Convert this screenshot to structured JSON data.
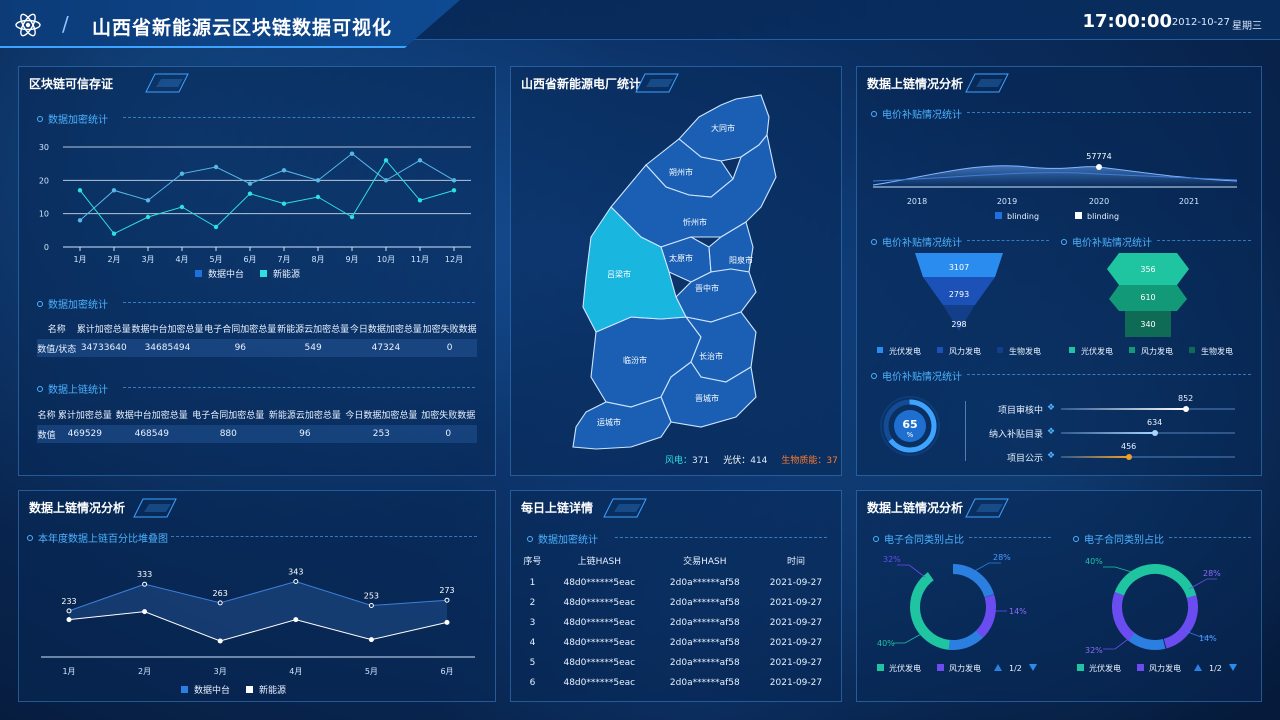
{
  "header": {
    "title": "山西省新能源云区块链数据可视化",
    "time": "17:00:00",
    "date": "2012-10-27",
    "weekday": "星期三",
    "logo_icon": "atom-icon"
  },
  "panel_tl": {
    "title": "区块链可信存证",
    "line_sub": "数据加密统计",
    "chart_data": {
      "type": "line",
      "categories": [
        "1月",
        "2月",
        "3月",
        "4月",
        "5月",
        "6月",
        "7月",
        "8月",
        "9月",
        "10月",
        "11月",
        "12月"
      ],
      "series": [
        {
          "name": "数据中台",
          "values": [
            8,
            17,
            14,
            22,
            24,
            19,
            23,
            20,
            28,
            20,
            26,
            20
          ]
        },
        {
          "name": "新能源",
          "values": [
            17,
            4,
            9,
            12,
            6,
            16,
            13,
            15,
            9,
            26,
            14,
            17
          ]
        }
      ],
      "yticks": [
        "0",
        "10",
        "20",
        "30"
      ],
      "ylim": [
        0,
        30
      ]
    },
    "table1": {
      "sub": "数据加密统计",
      "headers": [
        "名称",
        "累计加密总量",
        "数据中台加密总量",
        "电子合同加密总量",
        "新能源云加密总量",
        "今日数据加密总量",
        "加密失败数据"
      ],
      "row": [
        "数值/状态",
        "34733640",
        "34685494",
        "96",
        "549",
        "47324",
        "0"
      ]
    },
    "table2": {
      "sub": "数据上链统计",
      "headers": [
        "名称",
        "累计加密总量",
        "数据中台加密总量",
        "电子合同加密总量",
        "新能源云加密总量",
        "今日数据加密总量",
        "加密失败数据"
      ],
      "row": [
        "数值",
        "469529",
        "468549",
        "880",
        "96",
        "253",
        "0"
      ]
    }
  },
  "panel_map": {
    "title": "山西省新能源电厂统计",
    "cities": [
      "大同市",
      "朔州市",
      "忻州市",
      "吕梁市",
      "太原市",
      "阳泉市",
      "晋中市",
      "临汾市",
      "长治市",
      "晋城市",
      "运城市"
    ],
    "stats": [
      {
        "label": "风电：",
        "value": "371"
      },
      {
        "label": "光伏：",
        "value": "414"
      },
      {
        "label": "生物质能：",
        "value": "37"
      }
    ]
  },
  "panel_tr": {
    "title": "数据上链情况分析",
    "sub1": "电价补贴情况统计",
    "chart_data": {
      "type": "area",
      "x": [
        "2018",
        "2019",
        "2020",
        "2021"
      ],
      "series": [
        {
          "name": "blinding",
          "peak_label": "57774"
        },
        {
          "name": "blinding"
        }
      ]
    },
    "sub2": "电价补贴情况统计",
    "sub3": "电价补贴情况统计",
    "funnel1": {
      "values": [
        "3107",
        "2793",
        "298"
      ],
      "legend": [
        "光伏发电",
        "风力发电",
        "生物发电"
      ]
    },
    "funnel2": {
      "values": [
        "356",
        "610",
        "340"
      ],
      "legend": [
        "光伏发电",
        "风力发电",
        "生物发电"
      ]
    },
    "sub4": "电价补贴情况统计",
    "gauge": {
      "value": "65",
      "unit": "%"
    },
    "bars": [
      {
        "label": "项目审核中",
        "value": "852",
        "fraction": 0.72
      },
      {
        "label": "纳入补贴目录",
        "value": "634",
        "fraction": 0.54
      },
      {
        "label": "项目公示",
        "value": "456",
        "fraction": 0.39
      }
    ]
  },
  "panel_bl": {
    "title": "数据上链情况分析",
    "sub": "本年度数据上链百分比堆叠图",
    "chart_data": {
      "type": "line",
      "categories": [
        "1月",
        "2月",
        "3月",
        "4月",
        "5月",
        "6月"
      ],
      "series": [
        {
          "name": "数据中台",
          "values": [
            233,
            333,
            263,
            343,
            253,
            273
          ]
        },
        {
          "name": "新能源",
          "values": [
            200,
            230,
            120,
            200,
            125,
            190
          ]
        }
      ],
      "data_labels": [
        "233",
        "333",
        "263",
        "343",
        "253",
        "273"
      ]
    }
  },
  "panel_bc": {
    "title": "每日上链详情",
    "sub": "数据加密统计",
    "headers": [
      "序号",
      "上链HASH",
      "交易HASH",
      "时间"
    ],
    "rows": [
      [
        "1",
        "48d0******5eac",
        "2d0a******af58",
        "2021-09-27"
      ],
      [
        "2",
        "48d0******5eac",
        "2d0a******af58",
        "2021-09-27"
      ],
      [
        "3",
        "48d0******5eac",
        "2d0a******af58",
        "2021-09-27"
      ],
      [
        "4",
        "48d0******5eac",
        "2d0a******af58",
        "2021-09-27"
      ],
      [
        "5",
        "48d0******5eac",
        "2d0a******af58",
        "2021-09-27"
      ],
      [
        "6",
        "48d0******5eac",
        "2d0a******af58",
        "2021-09-27"
      ]
    ]
  },
  "panel_br": {
    "title": "数据上链情况分析",
    "donut1": {
      "sub": "电子合同类别占比",
      "labels": [
        "32%",
        "28%",
        "14%",
        "40%"
      ],
      "legend": [
        "光伏发电",
        "风力发电"
      ],
      "pager": "1/2"
    },
    "donut2": {
      "sub": "电子合同类别占比",
      "labels": [
        "40%",
        "28%",
        "14%",
        "32%"
      ],
      "legend": [
        "光伏发电",
        "风力发电"
      ],
      "pager": "1/2"
    }
  },
  "colors": {
    "accent": "#3ea2ff",
    "series_blue": "#1e6fe0",
    "series_cyan": "#2ee0e0",
    "map_blue": "#1a5fb4",
    "map_highlight": "#19b6e0",
    "orange": "#ff7a2a"
  }
}
